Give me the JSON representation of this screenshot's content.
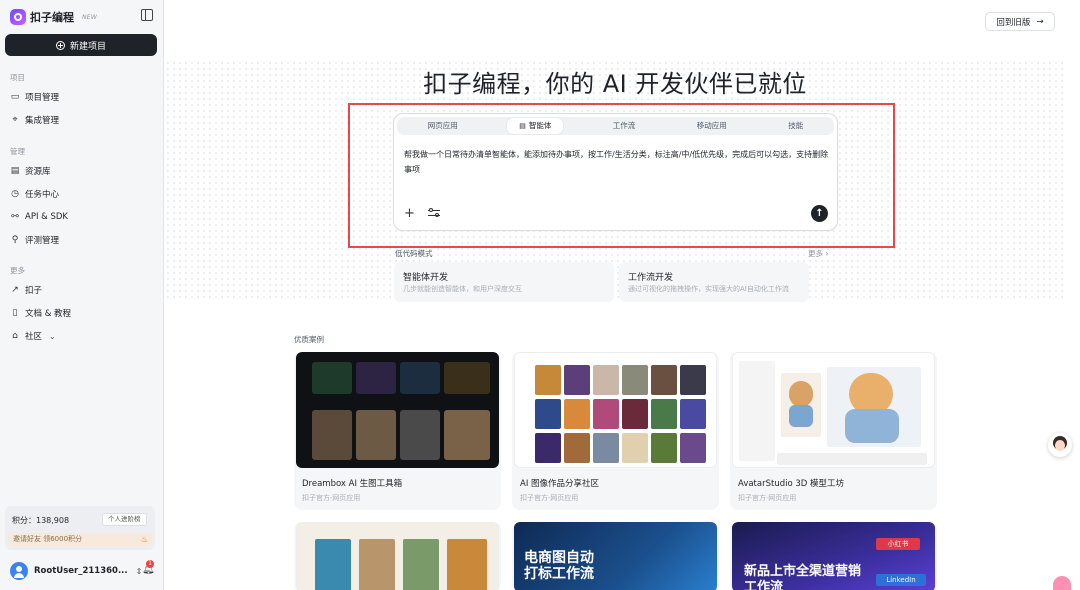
{
  "app": {
    "name": "扣子编程",
    "badge": "NEW"
  },
  "sidebar": {
    "new_project": "新建项目",
    "sections": [
      {
        "label": "项目",
        "items": [
          {
            "label": "项目管理",
            "icon": "folder-icon"
          },
          {
            "label": "集成管理",
            "icon": "plug-icon"
          }
        ]
      },
      {
        "label": "管理",
        "items": [
          {
            "label": "资源库",
            "icon": "library-icon"
          },
          {
            "label": "任务中心",
            "icon": "clock-icon"
          },
          {
            "label": "API & SDK",
            "icon": "api-icon"
          },
          {
            "label": "评测管理",
            "icon": "evaluate-icon"
          }
        ]
      },
      {
        "label": "更多",
        "items": [
          {
            "label": "扣子",
            "icon": "arrow-up-right-icon"
          },
          {
            "label": "文档 & 教程",
            "icon": "book-icon"
          },
          {
            "label": "社区",
            "icon": "store-icon"
          }
        ]
      }
    ],
    "points": {
      "label": "积分：138,908",
      "button": "个人进阶榜",
      "invite": "邀请好友 领6000积分"
    },
    "user": {
      "name": "RootUser_211360...",
      "notifications": "1"
    }
  },
  "header": {
    "back_button": "回到旧版"
  },
  "hero": {
    "title": "扣子编程，你的 AI 开发伙伴已就位"
  },
  "prompt": {
    "tabs": [
      "网页应用",
      "智能体",
      "工作流",
      "移动应用",
      "技能"
    ],
    "active_tab": "智能体",
    "text": "帮我做一个日常待办清单智能体，能添加待办事项，按工作/生活分类，标注高/中/低优先级，完成后可以勾选，支持删除事项"
  },
  "lowcode": {
    "label": "低代码模式",
    "more": "更多",
    "cards": [
      {
        "title": "智能体开发",
        "desc": "几步就能创造智能体，和用户深度交互"
      },
      {
        "title": "工作流开发",
        "desc": "通过可视化的拖拽操作，实现强大的AI自动化工作流"
      }
    ]
  },
  "cases": {
    "label": "优质案例",
    "items": [
      {
        "title": "Dreambox AI 生图工具箱",
        "sub": "扣子官方·网页应用"
      },
      {
        "title": "AI 图像作品分享社区",
        "sub": "扣子官方·网页应用"
      },
      {
        "title": "AvatarStudio 3D 模型工坊",
        "sub": "扣子官方·网页应用"
      }
    ],
    "row2": [
      {
        "thumb_text": ""
      },
      {
        "thumb_text": "电商图自动打标工作流"
      },
      {
        "thumb_text": "新品上市全渠道营销工作流",
        "tags": [
          "小红书",
          "LinkedIn"
        ]
      }
    ]
  },
  "colors": {
    "primary": "#1f2329",
    "highlight": "#e5484d",
    "bg_sidebar": "#f5f6f7"
  }
}
